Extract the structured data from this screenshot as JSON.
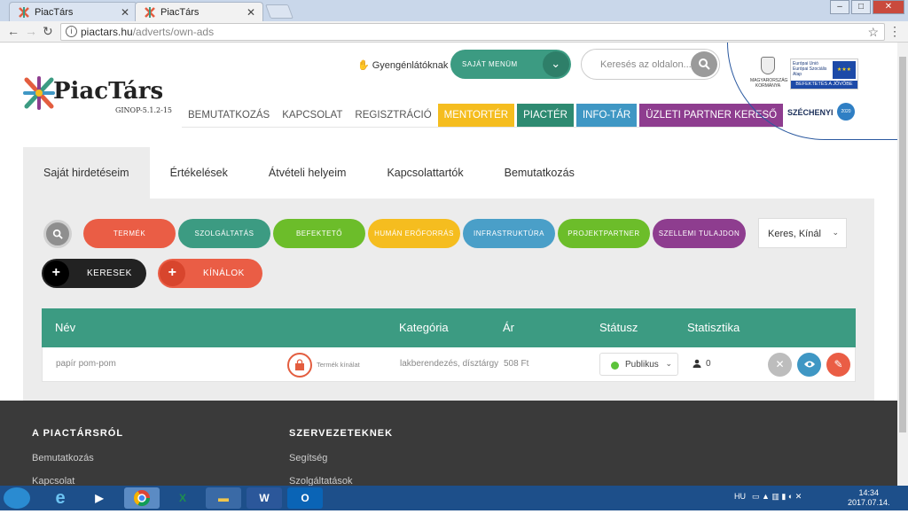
{
  "browser": {
    "tabs": [
      {
        "label": "PiacTárs",
        "active": false
      },
      {
        "label": "PiacTárs",
        "active": true
      }
    ],
    "url_domain": "piactars.hu",
    "url_path": "/adverts/own-ads"
  },
  "header": {
    "logo_name": "PiacTárs",
    "logo_sub": "GINOP-5.1.2-15",
    "helper_link": "Gyengénlátóknak",
    "menu_button": "SAJÁT MENÜM",
    "search_placeholder": "Keresés az oldalon...",
    "nav": [
      "BEMUTATKOZÁS",
      "KAPCSOLAT",
      "REGISZTRÁCIÓ",
      "MENTORTÉR",
      "PIACTÉR",
      "INFO-TÁR",
      "ÜZLETI PARTNER KERESŐ"
    ],
    "eu": {
      "crest_text": "MAGYARORSZÁG KORMÁNYA",
      "box_text": "Európai Unió Európai Szociális Alap",
      "band_text": "BEFEKTETÉS A JÖVŐBE",
      "szechenyi": "SZÉCHENYI",
      "year": "2020"
    }
  },
  "subtabs": [
    "Saját hirdetéseim",
    "Értékelések",
    "Átvételi helyeim",
    "Kapcsolattartók",
    "Bemutatkozás"
  ],
  "filters": {
    "categories": [
      {
        "label": "TERMÉK",
        "color": "#ea5d45"
      },
      {
        "label": "SZOLGÁLTATÁS",
        "color": "#3c9b82"
      },
      {
        "label": "BEFEKTETŐ",
        "color": "#6cbd2a"
      },
      {
        "label": "HUMÁN ERŐFORRÁS",
        "color": "#f5bd1f"
      },
      {
        "label": "INFRASTRUKTÚRA",
        "color": "#4a9fc8"
      },
      {
        "label": "PROJEKTPARTNER",
        "color": "#6cbd2a"
      },
      {
        "label": "SZELLEMI TULAJDON",
        "color": "#8e3d8f"
      }
    ],
    "select_value": "Keres, Kínál",
    "actions": [
      {
        "label": "KERESEK",
        "color": "#222222"
      },
      {
        "label": "KÍNÁLOK",
        "color": "#ea5d45"
      }
    ]
  },
  "table": {
    "columns": [
      "Név",
      "Kategória",
      "Ár",
      "Státusz",
      "Statisztika"
    ],
    "rows": [
      {
        "name": "papír pom-pom",
        "type": "Termék kínálat",
        "category": "lakberendezés, dísztárgy",
        "price": "508 Ft",
        "status": "Publikus",
        "views": "0"
      }
    ]
  },
  "footer": {
    "col1_title": "A PIACTÁRSRÓL",
    "col1_links": [
      "Bemutatkozás",
      "Kapcsolat"
    ],
    "col2_title": "SZERVEZETEKNEK",
    "col2_links": [
      "Segítség",
      "Szolgáltatások"
    ]
  },
  "taskbar": {
    "lang": "HU",
    "time": "14:34",
    "date": "2017.07.14."
  }
}
